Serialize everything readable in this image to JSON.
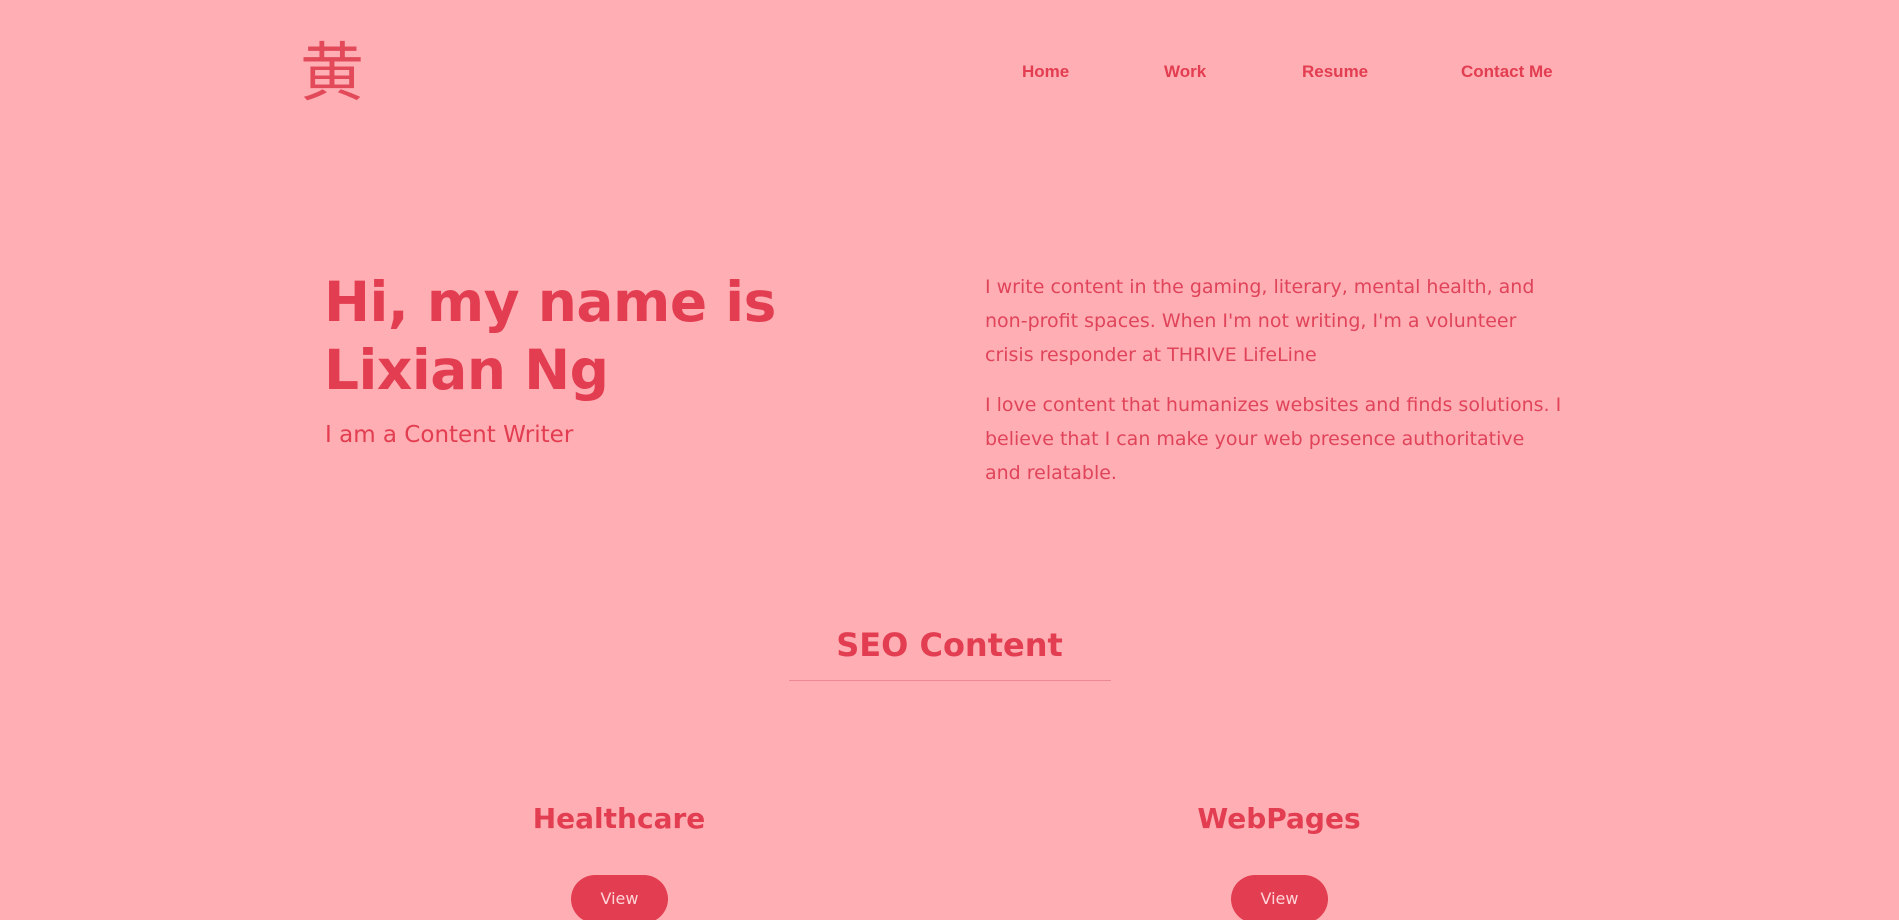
{
  "header": {
    "logo": "黄",
    "nav": [
      "Home",
      "Work",
      "Resume",
      "Contact Me"
    ]
  },
  "hero": {
    "title": "Hi, my name is Lixian Ng",
    "subtitle": "I am a Content Writer",
    "bio": [
      "I write content in the gaming, literary, mental health, and non-profit spaces. When I'm not writing, I'm a volunteer crisis responder at THRIVE LifeLine",
      "I love content that humanizes websites and finds solutions. I believe that I can make your web presence authoritative and relatable."
    ]
  },
  "section": {
    "title": "SEO Content",
    "cards": [
      {
        "title": "Healthcare",
        "button": "View"
      },
      {
        "title": "WebPages",
        "button": "View"
      }
    ]
  },
  "colors": {
    "background": "#FFAEB4",
    "accent": "#E23D50",
    "button_text": "#FFD5D9"
  }
}
